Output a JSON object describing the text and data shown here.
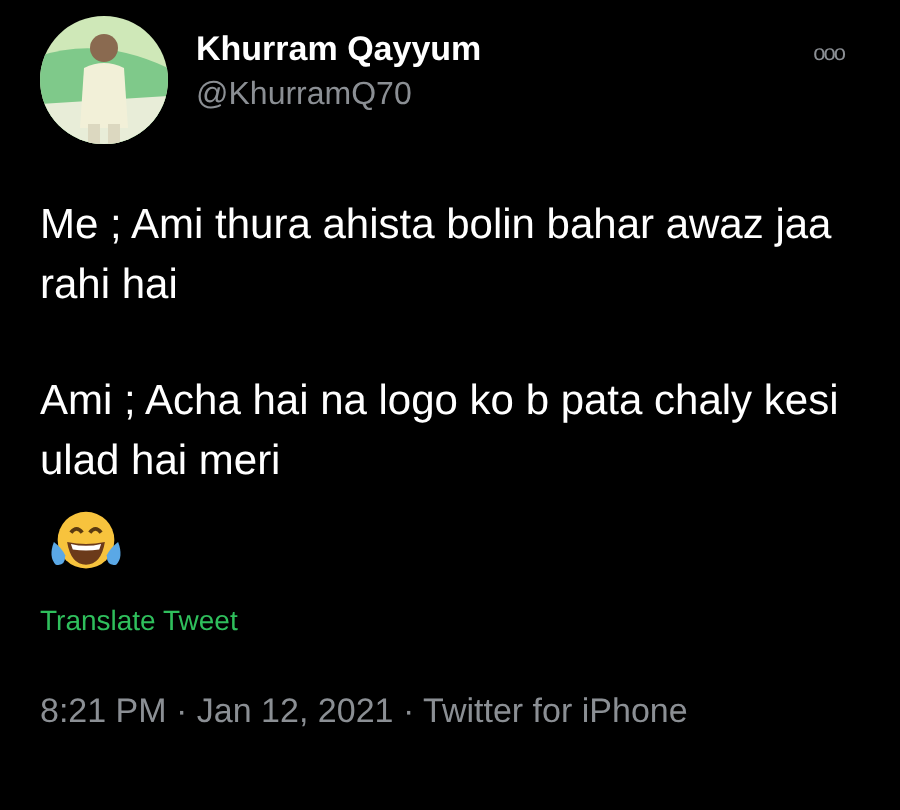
{
  "author": {
    "name": "Khurram Qayyum",
    "handle": "@KhurramQ70"
  },
  "menu": "ooo",
  "body": [
    "Me ; Ami thura ahista bolin bahar awaz jaa rahi hai",
    "Ami ; Acha hai na logo ko b pata chaly kesi ulad hai meri"
  ],
  "translate": "Translate Tweet",
  "meta": "8:21 PM · Jan 12, 2021 · Twitter for iPhone"
}
